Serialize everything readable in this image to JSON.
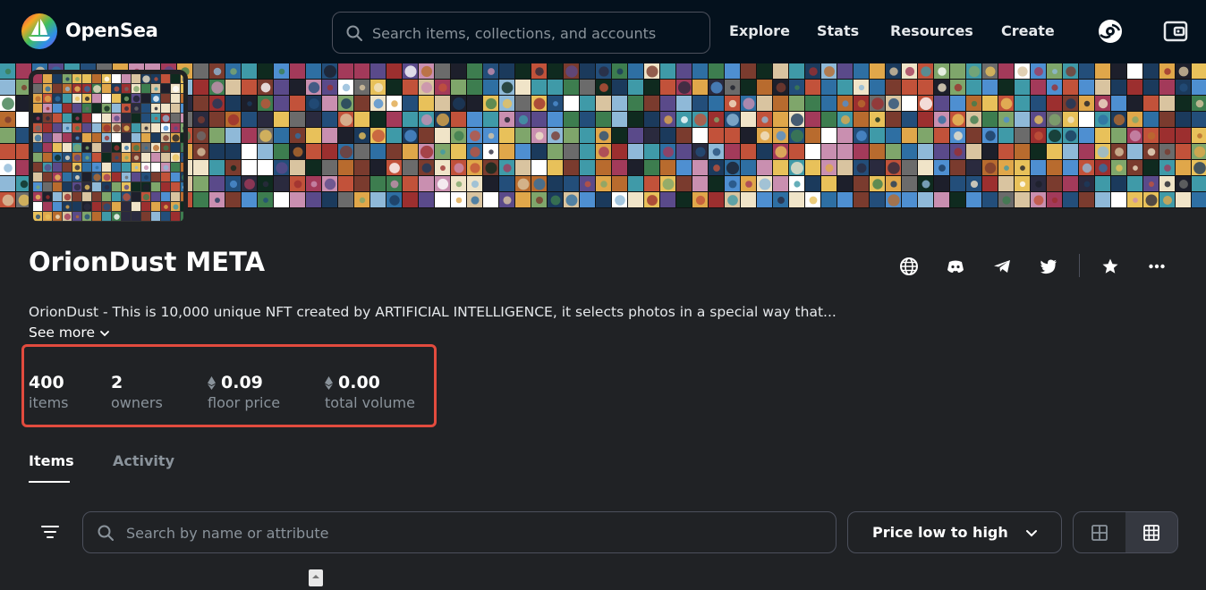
{
  "header": {
    "brand": "OpenSea",
    "search_placeholder": "Search items, collections, and accounts",
    "nav": [
      "Explore",
      "Stats",
      "Resources",
      "Create"
    ],
    "icons": [
      "account-icon",
      "wallet-icon"
    ]
  },
  "collection": {
    "title": "OrionDust META",
    "description": "OrionDust - This is 10,000 unique NFT created by ARTIFICIAL INTELLIGENCE, it selects photos in a special way that...",
    "see_more": "See more",
    "social_icons": [
      "globe-icon",
      "discord-icon",
      "telegram-icon",
      "twitter-icon",
      "star-icon",
      "more-icon"
    ]
  },
  "stats": {
    "items": {
      "value": "400",
      "label": "items"
    },
    "owners": {
      "value": "2",
      "label": "owners"
    },
    "floor": {
      "value": "0.09",
      "label": "floor price"
    },
    "volume": {
      "value": "0.00",
      "label": "total volume"
    }
  },
  "tabs": {
    "items": "Items",
    "activity": "Activity",
    "active": "Items"
  },
  "filters": {
    "search_placeholder": "Search by name or attribute",
    "sort": "Price low to high"
  },
  "colors": {
    "header_bg": "#04111d",
    "page_bg": "#202225",
    "highlight": "#e24b3e",
    "muted_text": "#8a939b"
  }
}
